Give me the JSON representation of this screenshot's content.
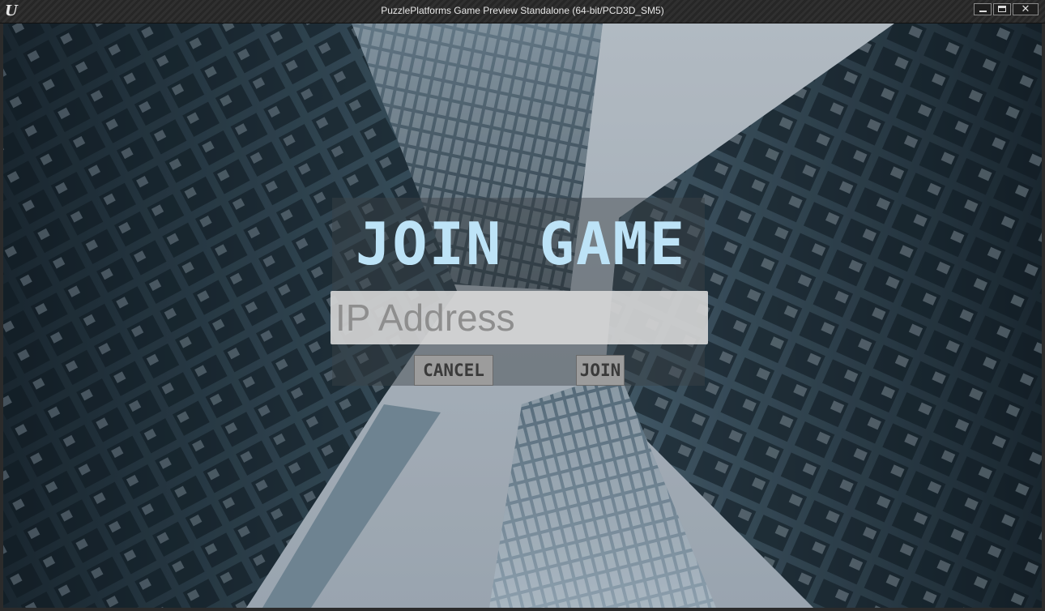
{
  "window": {
    "title": "PuzzlePlatforms Game Preview Standalone (64-bit/PCD3D_SM5)",
    "logo_glyph": "U",
    "logo_icon": "unreal-engine-logo-icon",
    "minimize_icon": "minimize-icon",
    "maximize_icon": "maximize-icon",
    "close_icon": "close-icon",
    "close_glyph": "✕"
  },
  "menu": {
    "title": "JOIN GAME",
    "ip_field": {
      "value": "",
      "placeholder": "IP Address"
    },
    "cancel_label": "CANCEL",
    "join_label": "JOIN"
  },
  "colors": {
    "title_text": "#bde3f7",
    "button_bg": "#9c9c9c",
    "input_bg": "#dcdcdc"
  }
}
